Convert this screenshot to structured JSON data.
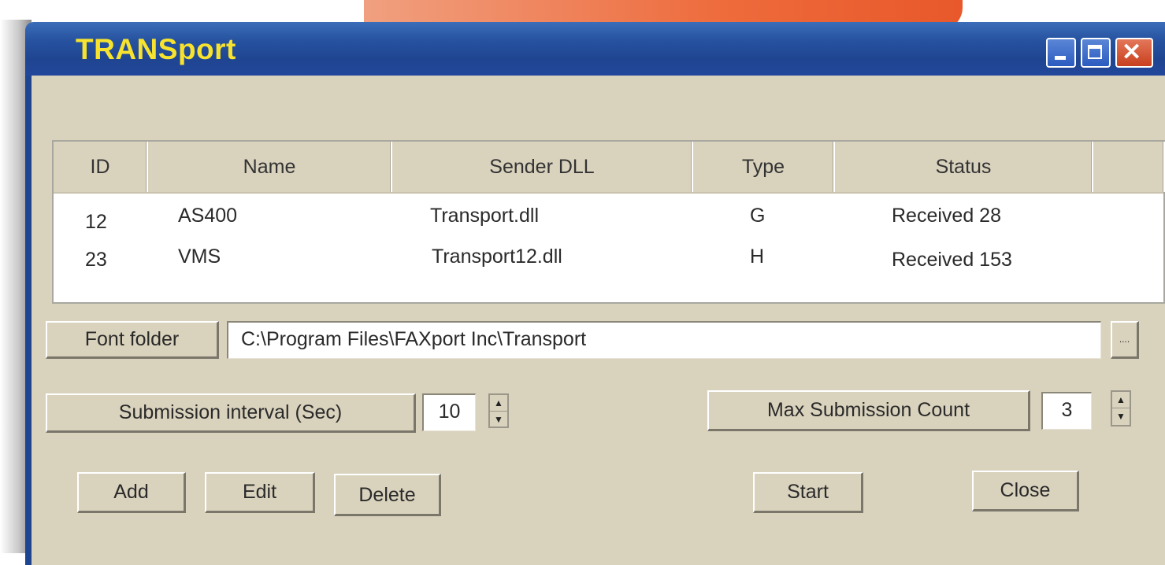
{
  "window": {
    "title": "TRANSport",
    "title_color": "#f7e32e",
    "titlebar_color": "#2652a0",
    "body_color": "#d9d2bd",
    "caption_buttons": [
      "minimize-icon",
      "maximize-icon",
      "close-icon"
    ]
  },
  "list": {
    "columns": [
      "ID",
      "Name",
      "Sender DLL",
      "Type",
      "Status"
    ],
    "rows": [
      {
        "id": "12",
        "name": "AS400",
        "dll": "Transport.dll",
        "type": "G",
        "status": "Received 28"
      },
      {
        "id": "23",
        "name": "VMS",
        "dll": "Transport12.dll",
        "type": "H",
        "status": "Received 153"
      }
    ]
  },
  "font": {
    "button_label": "Font folder",
    "path": "C:\\Program Files\\FAXport Inc\\Transport",
    "browse_label": "...."
  },
  "interval": {
    "button_label": "Submission interval (Sec)",
    "value": "10"
  },
  "max_count": {
    "button_label": "Max Submission Count",
    "value": "3"
  },
  "actions": {
    "add": "Add",
    "edit": "Edit",
    "delete": "Delete",
    "start": "Start",
    "close": "Close"
  }
}
